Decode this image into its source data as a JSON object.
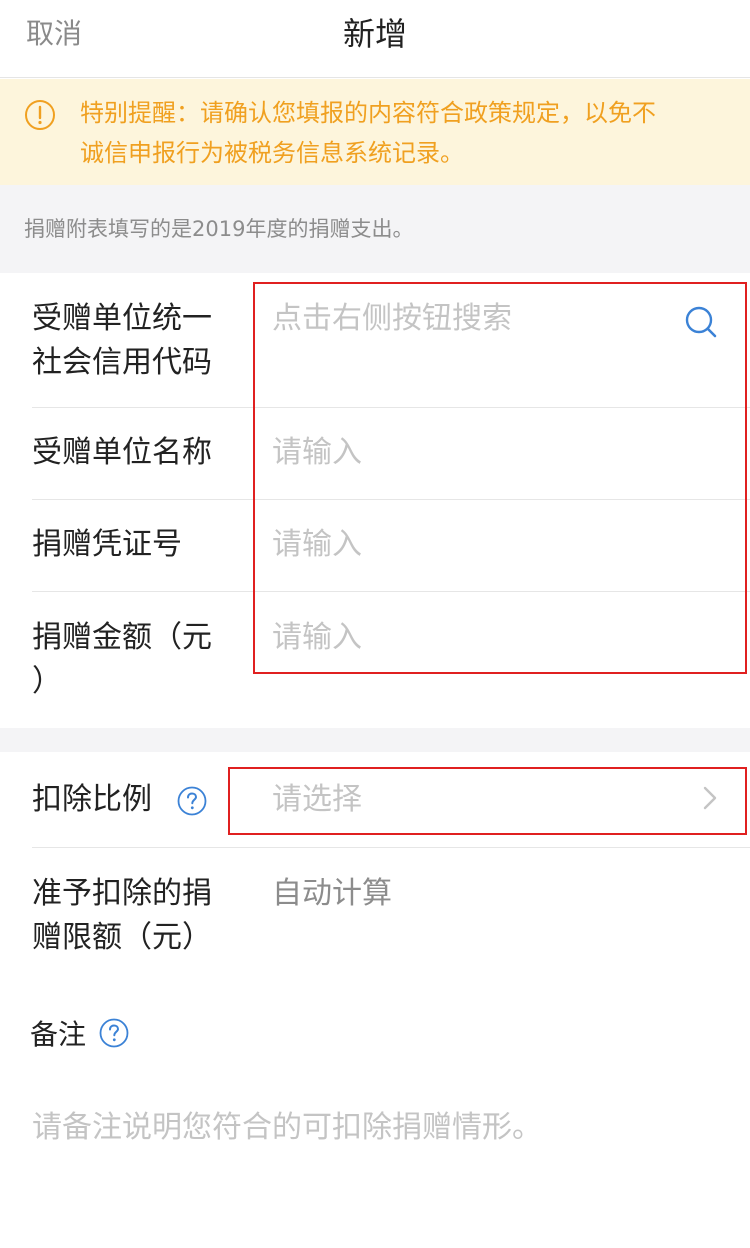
{
  "header": {
    "cancel_label": "取消",
    "title": "新增"
  },
  "alert": {
    "icon": "warning-circle-icon",
    "text_line1": "特别提醒：请确认您填报的内容符合政策规定，以免不",
    "text_line2": "诚信申报行为被税务信息系统记录。",
    "color": "#f0a020",
    "background": "#fdf5dc"
  },
  "note": {
    "text": "捐赠附表填写的是2019年度的捐赠支出。"
  },
  "form": {
    "credit_code": {
      "label_line1": "受赠单位统一",
      "label_line2": "社会信用代码",
      "placeholder": "点击右侧按钮搜索",
      "icon": "search-icon"
    },
    "unit_name": {
      "label": "受赠单位名称",
      "placeholder": "请输入"
    },
    "voucher_no": {
      "label": "捐赠凭证号",
      "placeholder": "请输入"
    },
    "amount": {
      "label_line1": "捐赠金额（元",
      "label_line2": "）",
      "placeholder": "请输入"
    },
    "deduction_ratio": {
      "label": "扣除比例",
      "placeholder": "请选择",
      "help_icon": "help-circle-icon",
      "chevron_icon": "chevron-right-icon"
    },
    "deduction_limit": {
      "label_line1": "准予扣除的捐",
      "label_line2": "赠限额（元）",
      "value": "自动计算"
    },
    "remark": {
      "label": "备注",
      "help_icon": "help-circle-icon",
      "placeholder": "请备注说明您符合的可扣除捐赠情形。"
    }
  },
  "colors": {
    "accent_blue": "#3b82d6",
    "highlight_red": "#e02020",
    "placeholder_gray": "#c4c4c4"
  }
}
